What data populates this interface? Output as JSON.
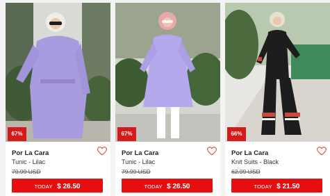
{
  "products": [
    {
      "discount": "67%",
      "brand": "Por La Cara",
      "name": "Tunic - Lilac",
      "old_price": "79.99 USD",
      "today_label": "TODAY",
      "price": "$ 26.50",
      "icons": {
        "wishlist": "heart-outline-icon"
      }
    },
    {
      "discount": "67%",
      "brand": "Por La Cara",
      "name": "Tunic - Lilac",
      "old_price": "79.99 USD",
      "today_label": "TODAY",
      "price": "$ 26.50",
      "icons": {
        "wishlist": "heart-outline-icon"
      }
    },
    {
      "discount": "66%",
      "brand": "Por La Cara",
      "name": "Knit Suits - Black",
      "old_price": "62.99 USD",
      "today_label": "TODAY",
      "price": "$ 21.50",
      "icons": {
        "wishlist": "heart-outline-icon"
      }
    }
  ],
  "colors": {
    "accent": "#e50f0f",
    "badge": "#d41a1a",
    "lilac": "#a99be0",
    "heart": "#e0523d"
  }
}
